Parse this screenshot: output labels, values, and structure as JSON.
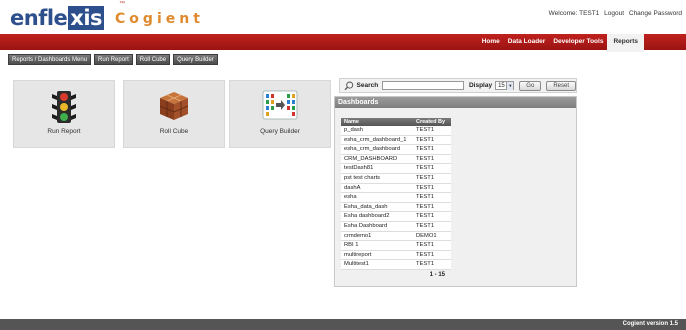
{
  "header": {
    "logo_prefix": "enfle",
    "logo_box": "xis",
    "product": "Cogient",
    "tm": "™",
    "welcome": "Welcome: TEST1",
    "logout": "Logout",
    "change_password": "Change Password"
  },
  "nav": {
    "items": [
      {
        "label": "Home"
      },
      {
        "label": "Data Loader"
      },
      {
        "label": "Developer Tools"
      },
      {
        "label": "Reports"
      }
    ],
    "active": "Reports"
  },
  "toolbar": {
    "buttons": [
      {
        "label": "Reports / Dashboards Menu"
      },
      {
        "label": "Run Report"
      },
      {
        "label": "Roll Cube"
      },
      {
        "label": "Query Builder"
      }
    ]
  },
  "tiles": [
    {
      "label": "Run Report",
      "icon": "traffic-light-icon"
    },
    {
      "label": "Roll Cube",
      "icon": "cube-icon"
    },
    {
      "label": "Query Builder",
      "icon": "query-builder-icon"
    }
  ],
  "search": {
    "label": "Search",
    "display_label": "Display",
    "display_value": "15",
    "go_label": "Go",
    "reset_label": "Reset"
  },
  "dashboards": {
    "title": "Dashboards",
    "columns": [
      "Name",
      "Created By"
    ],
    "rows": [
      [
        "p_dash",
        "TEST1"
      ],
      [
        "esha_crm_dashboard_1",
        "TEST1"
      ],
      [
        "esha_crm_dashboard",
        "TEST1"
      ],
      [
        "CRM_DASHBOARD",
        "TEST1"
      ],
      [
        "testDash81",
        "TEST1"
      ],
      [
        "pst test charts",
        "TEST1"
      ],
      [
        "dashA",
        "TEST1"
      ],
      [
        "esha",
        "TEST1"
      ],
      [
        "Esha_data_dash",
        "TEST1"
      ],
      [
        "Esha dashboard2",
        "TEST1"
      ],
      [
        "Esha Dashboard",
        "TEST1"
      ],
      [
        "crmdemo1",
        "DEMO1"
      ],
      [
        "RBI 1",
        "TEST1"
      ],
      [
        "multireport",
        "TEST1"
      ],
      [
        "Multitest1",
        "TEST1"
      ]
    ],
    "pager": "1 - 15"
  },
  "footer": {
    "version": "Cogient version 1.5"
  }
}
